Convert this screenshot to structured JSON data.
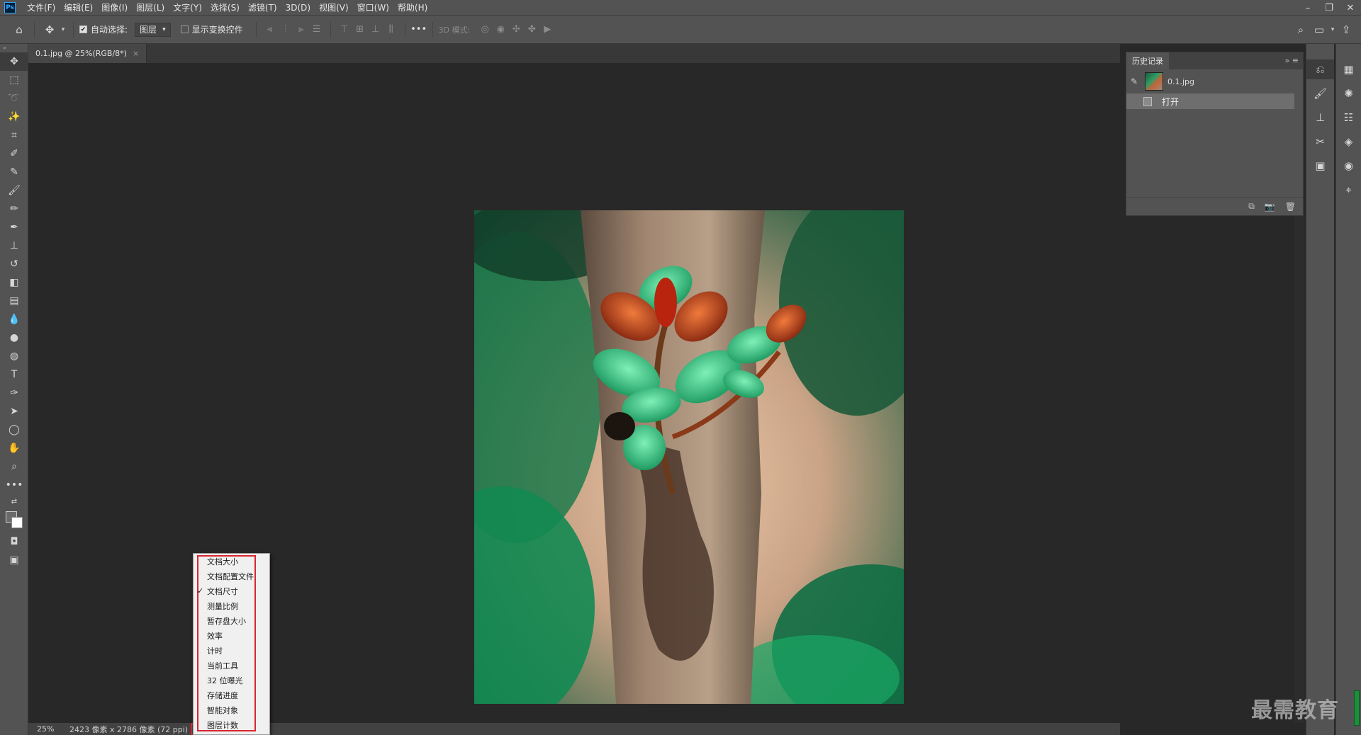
{
  "app": {
    "menu": [
      "文件(F)",
      "编辑(E)",
      "图像(I)",
      "图层(L)",
      "文字(Y)",
      "选择(S)",
      "滤镜(T)",
      "3D(D)",
      "视图(V)",
      "窗口(W)",
      "帮助(H)"
    ],
    "logo_text": "Ps"
  },
  "options": {
    "auto_select_label": "自动选择:",
    "auto_select_value": "图层",
    "show_transform_label": "显示变换控件",
    "mode_3d_label": "3D 模式:"
  },
  "document": {
    "tab_title": "0.1.jpg @ 25%(RGB/8*)",
    "tab_close": "×"
  },
  "status": {
    "zoom": "25%",
    "info": "2423 像素 x 2786 像素 (72 ppi)",
    "arrow": ">"
  },
  "status_menu": {
    "items": [
      {
        "label": "文档大小",
        "checked": false
      },
      {
        "label": "文档配置文件",
        "checked": false
      },
      {
        "label": "文档尺寸",
        "checked": true
      },
      {
        "label": "测量比例",
        "checked": false
      },
      {
        "label": "暂存盘大小",
        "checked": false
      },
      {
        "label": "效率",
        "checked": false
      },
      {
        "label": "计时",
        "checked": false
      },
      {
        "label": "当前工具",
        "checked": false
      },
      {
        "label": "32 位曝光",
        "checked": false
      },
      {
        "label": "存储进度",
        "checked": false
      },
      {
        "label": "智能对象",
        "checked": false
      },
      {
        "label": "图层计数",
        "checked": false
      }
    ],
    "check_glyph": "✓"
  },
  "history": {
    "tab_label": "历史记录",
    "snapshot_name": "0.1.jpg",
    "state_label": "打开"
  },
  "watermark": "最需教育",
  "colors": {
    "highlight_red": "#d9262f",
    "panel": "#535353",
    "canvas_bg": "#282828"
  }
}
